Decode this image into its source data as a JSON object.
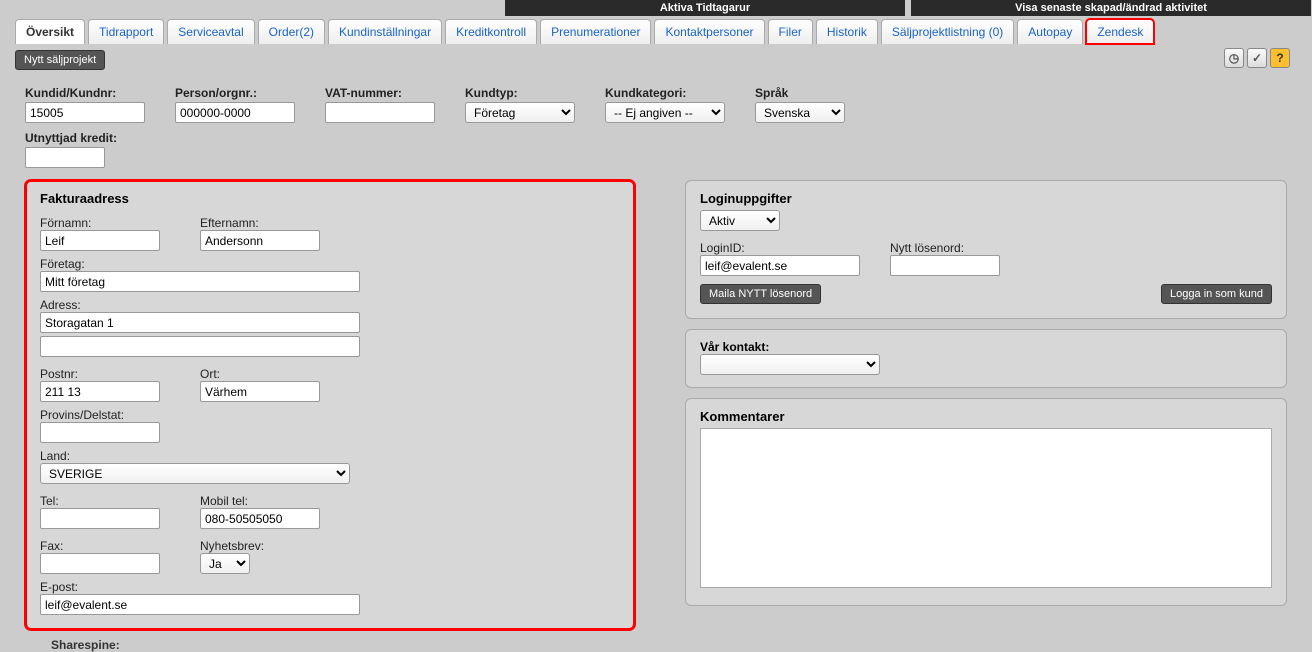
{
  "topbar": {
    "active_timers": "Aktiva Tidtagarur",
    "recent_activity": "Visa senaste skapad/ändrad aktivitet"
  },
  "tabs": [
    {
      "label": "Översikt",
      "active": true
    },
    {
      "label": "Tidrapport"
    },
    {
      "label": "Serviceavtal"
    },
    {
      "label": "Order(2)"
    },
    {
      "label": "Kundinställningar"
    },
    {
      "label": "Kreditkontroll"
    },
    {
      "label": "Prenumerationer"
    },
    {
      "label": "Kontaktpersoner"
    },
    {
      "label": "Filer"
    },
    {
      "label": "Historik"
    },
    {
      "label": "Säljprojektlistning (0)"
    },
    {
      "label": "Autopay"
    },
    {
      "label": "Zendesk",
      "highlight": true
    }
  ],
  "buttons": {
    "new_salesproject": "Nytt säljprojekt",
    "mail_password": "Maila NYTT lösenord",
    "login_as_customer": "Logga in som kund"
  },
  "top_fields": {
    "kundid_label": "Kundid/Kundnr:",
    "kundid_value": "15005",
    "orgnr_label": "Person/orgnr.:",
    "orgnr_value": "000000-0000",
    "vat_label": "VAT-nummer:",
    "vat_value": "",
    "kundtyp_label": "Kundtyp:",
    "kundtyp_value": "Företag",
    "kundkat_label": "Kundkategori:",
    "kundkat_value": "-- Ej angiven --",
    "sprak_label": "Språk",
    "sprak_value": "Svenska",
    "kredit_label": "Utnyttjad kredit:",
    "kredit_value": ""
  },
  "invoice": {
    "title": "Fakturaadress",
    "fornamn_label": "Förnamn:",
    "fornamn": "Leif",
    "efternamn_label": "Efternamn:",
    "efternamn": "Andersonn",
    "foretag_label": "Företag:",
    "foretag": "Mitt företag",
    "adress_label": "Adress:",
    "adress1": "Storagatan 1",
    "adress2": "",
    "postnr_label": "Postnr:",
    "postnr": "211 13",
    "ort_label": "Ort:",
    "ort": "Värhem",
    "provins_label": "Provins/Delstat:",
    "provins": "",
    "land_label": "Land:",
    "land": "SVERIGE",
    "tel_label": "Tel:",
    "tel": "",
    "mobil_label": "Mobil tel:",
    "mobil": "080-50505050",
    "fax_label": "Fax:",
    "fax": "",
    "nyhetsbrev_label": "Nyhetsbrev:",
    "nyhetsbrev": "Ja",
    "epost_label": "E-post:",
    "epost": "leif@evalent.se"
  },
  "login": {
    "title": "Loginuppgifter",
    "status": "Aktiv",
    "loginid_label": "LoginID:",
    "loginid": "leif@evalent.se",
    "newpass_label": "Nytt lösenord:",
    "newpass": ""
  },
  "contact": {
    "title": "Vår kontakt:",
    "value": ""
  },
  "comments": {
    "title": "Kommentarer",
    "value": ""
  },
  "footer": {
    "sharespine": "Sharespine:"
  }
}
